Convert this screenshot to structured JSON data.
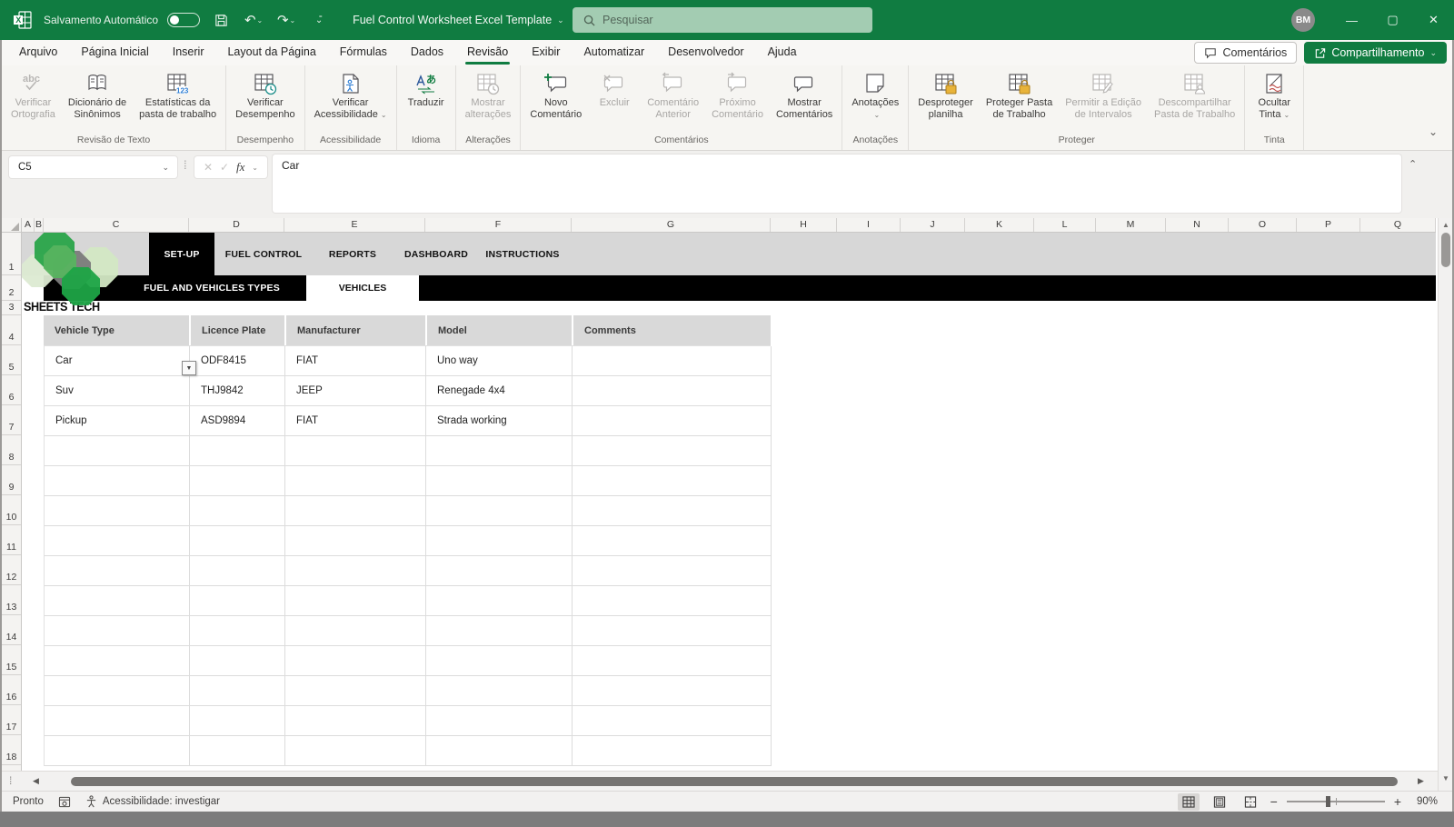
{
  "colors": {
    "titlebar_green": "#107c41",
    "accent_green": "#107c41",
    "banner_black": "#000000",
    "banner_gray": "#d7d7d7",
    "table_header_gray": "#d9d9d9",
    "lock_gold": "#e8b339",
    "ink_red": "#c0504d"
  },
  "title_bar": {
    "autosave_label": "Salvamento Automático",
    "autosave_state": "off",
    "document_title": "Fuel Control Worksheet Excel Template",
    "search_placeholder": "Pesquisar",
    "avatar_initials": "BM"
  },
  "menu_bar": {
    "items": [
      "Arquivo",
      "Página Inicial",
      "Inserir",
      "Layout da Página",
      "Fórmulas",
      "Dados",
      "Revisão",
      "Exibir",
      "Automatizar",
      "Desenvolvedor",
      "Ajuda"
    ],
    "active_item": "Revisão",
    "comments_button": "Comentários",
    "share_button": "Compartilhamento"
  },
  "ribbon": {
    "groups": [
      {
        "label": "Revisão de Texto",
        "buttons": [
          {
            "lines": [
              "Verificar",
              "Ortografia"
            ],
            "icon": "spelling",
            "disabled": true
          },
          {
            "lines": [
              "Dicionário de",
              "Sinônimos"
            ],
            "icon": "thesaurus"
          },
          {
            "lines": [
              "Estatísticas da",
              "pasta de trabalho"
            ],
            "icon": "workbook-stats"
          }
        ]
      },
      {
        "label": "Desempenho",
        "buttons": [
          {
            "lines": [
              "Verificar",
              "Desempenho"
            ],
            "icon": "check-performance"
          }
        ]
      },
      {
        "label": "Acessibilidade",
        "buttons": [
          {
            "lines": [
              "Verificar",
              "Acessibilidade"
            ],
            "icon": "accessibility",
            "chevron": true
          }
        ]
      },
      {
        "label": "Idioma",
        "buttons": [
          {
            "lines": [
              "Traduzir"
            ],
            "icon": "translate"
          }
        ]
      },
      {
        "label": "Alterações",
        "buttons": [
          {
            "lines": [
              "Mostrar",
              "alterações"
            ],
            "icon": "show-changes",
            "disabled": true
          }
        ]
      },
      {
        "label": "Comentários",
        "buttons": [
          {
            "lines": [
              "Novo",
              "Comentário"
            ],
            "icon": "new-comment"
          },
          {
            "lines": [
              "Excluir"
            ],
            "icon": "delete-comment",
            "disabled": true
          },
          {
            "lines": [
              "Comentário",
              "Anterior"
            ],
            "icon": "previous-comment",
            "disabled": true
          },
          {
            "lines": [
              "Próximo",
              "Comentário"
            ],
            "icon": "next-comment",
            "disabled": true
          },
          {
            "lines": [
              "Mostrar",
              "Comentários"
            ],
            "icon": "show-comments"
          }
        ]
      },
      {
        "label": "Anotações",
        "buttons": [
          {
            "lines": [
              "Anotações"
            ],
            "icon": "notes",
            "chevron": "below"
          }
        ]
      },
      {
        "label": "Proteger",
        "buttons": [
          {
            "lines": [
              "Desproteger",
              "planilha"
            ],
            "icon": "unprotect-sheet"
          },
          {
            "lines": [
              "Proteger Pasta",
              "de Trabalho"
            ],
            "icon": "protect-workbook"
          },
          {
            "lines": [
              "Permitir a Edição",
              "de Intervalos"
            ],
            "icon": "allow-edit",
            "disabled": true
          },
          {
            "lines": [
              "Descompartilhar",
              "Pasta de Trabalho"
            ],
            "icon": "unshare-workbook",
            "disabled": true
          }
        ]
      },
      {
        "label": "Tinta",
        "buttons": [
          {
            "lines": [
              "Ocultar",
              "Tinta"
            ],
            "icon": "hide-ink",
            "chevron": true
          }
        ]
      }
    ]
  },
  "formula_bar": {
    "cell_reference": "C5",
    "formula_value": "Car",
    "fx_label": "fx"
  },
  "grid": {
    "column_letters": [
      "A",
      "B",
      "C",
      "D",
      "E",
      "F",
      "G",
      "H",
      "I",
      "J",
      "K",
      "L",
      "M",
      "N",
      "O",
      "P",
      "Q"
    ],
    "row_numbers": [
      1,
      2,
      3,
      4,
      5,
      6,
      7,
      8,
      9,
      10,
      11,
      12,
      13,
      14,
      15,
      16,
      17,
      18
    ]
  },
  "sheet": {
    "nav_tabs": [
      {
        "label": "SET-UP",
        "active": true
      },
      {
        "label": "FUEL CONTROL",
        "active": false
      },
      {
        "label": "REPORTS",
        "active": false
      },
      {
        "label": "DASHBOARD",
        "active": false
      },
      {
        "label": "INSTRUCTIONS",
        "active": false
      }
    ],
    "sub_tabs": [
      {
        "label": "FUEL AND VEHICLES TYPES",
        "active": false
      },
      {
        "label": "VEHICLES",
        "active": true
      }
    ],
    "logo_text": "SHEETS TECH",
    "table": {
      "headers": [
        "Vehicle Type",
        "Licence Plate",
        "Manufacturer",
        "Model",
        "Comments"
      ],
      "rows": [
        [
          "Car",
          "ODF8415",
          "FIAT",
          "Uno way",
          ""
        ],
        [
          "Suv",
          "THJ9842",
          "JEEP",
          "Renegade 4x4",
          ""
        ],
        [
          "Pickup",
          "ASD9894",
          "FIAT",
          "Strada working",
          ""
        ]
      ],
      "empty_row_count": 11
    }
  },
  "status_bar": {
    "mode": "Pronto",
    "accessibility_text": "Acessibilidade: investigar",
    "zoom_level": "90%"
  }
}
